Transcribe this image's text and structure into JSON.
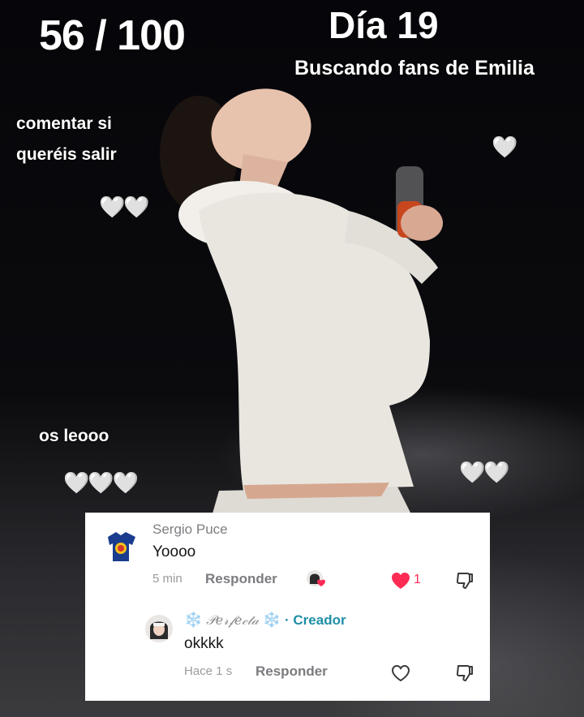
{
  "overlay": {
    "counter": "56 / 100",
    "day": "Día 19",
    "subtitle": "Buscando fans de Emilia",
    "comment_prompt": "comentar si queréis salir",
    "reply_text": "os leooo",
    "hearts_right_top": "🤍",
    "hearts_left": "🤍🤍",
    "hearts_bottom_left": "🤍🤍🤍",
    "hearts_bottom_right": "🤍🤍"
  },
  "comment": {
    "username": "Sergio Puce",
    "text": "Yoooo",
    "time": "5 min",
    "reply_label": "Responder",
    "likes": "1",
    "like_color": "#fe2c55"
  },
  "reply": {
    "snowflake": "❄️",
    "username": "𝒫𝑒𝓇𝒻𝑒𝒸𝓉𝒶",
    "separator": "·",
    "creator_label": "Creador",
    "text": "okkkk",
    "time": "Hace 1 s",
    "reply_label": "Responder",
    "creator_color": "#1f8fa6"
  }
}
